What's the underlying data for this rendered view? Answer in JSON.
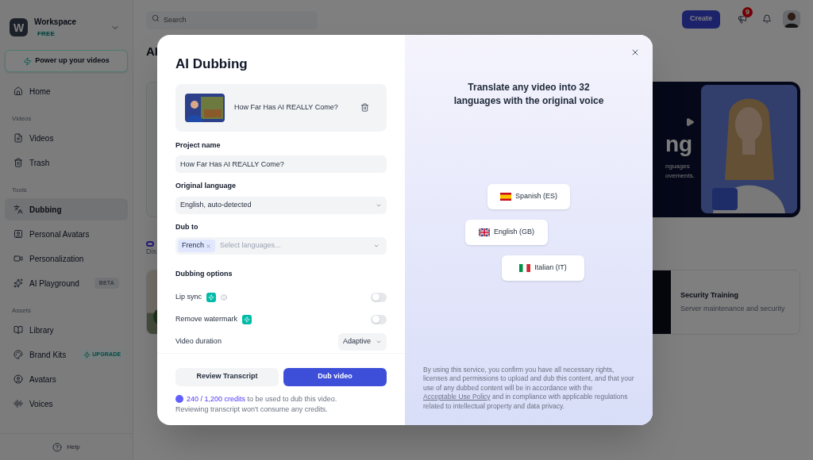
{
  "sidebar": {
    "workspace": {
      "initial": "W",
      "name": "Workspace",
      "plan": "FREE"
    },
    "promo_button": "Power up your videos",
    "sections": [
      {
        "items": [
          {
            "label": "Home",
            "selected": false
          }
        ]
      },
      {
        "heading": "Videos",
        "items": [
          {
            "label": "Videos",
            "selected": false
          },
          {
            "label": "Trash",
            "selected": false
          }
        ]
      },
      {
        "heading": "Tools",
        "items": [
          {
            "label": "Dubbing",
            "selected": true
          },
          {
            "label": "Personal Avatars",
            "selected": false
          },
          {
            "label": "Personalization",
            "selected": false
          },
          {
            "label": "AI Playground",
            "selected": false,
            "badge": {
              "kind": "beta",
              "text": "BETA"
            }
          }
        ]
      },
      {
        "heading": "Assets",
        "items": [
          {
            "label": "Library",
            "selected": false
          },
          {
            "label": "Brand Kits",
            "selected": false,
            "badge": {
              "kind": "upgrade",
              "text": "UPGRADE"
            }
          },
          {
            "label": "Avatars",
            "selected": false
          },
          {
            "label": "Voices",
            "selected": false
          }
        ]
      }
    ],
    "help": "Help"
  },
  "header": {
    "search": {
      "placeholder": "Search"
    },
    "create_button": "Create",
    "notification_count": "9"
  },
  "background": {
    "heading": "AI",
    "hero": {
      "headline": "ng",
      "line_1": "nguages",
      "line_2": "ovements."
    },
    "section_label": "Dis",
    "card": {
      "title": "Security Training",
      "subtitle": "Server maintenance and security"
    }
  },
  "modal": {
    "title": "AI Dubbing",
    "video": {
      "title": "How Far Has AI REALLY Come?"
    },
    "project_name": {
      "label": "Project name",
      "value": "How Far Has AI REALLY Come?"
    },
    "original_language": {
      "label": "Original language",
      "value": "English, auto-detected"
    },
    "dub_to": {
      "label": "Dub to",
      "tags": [
        "French"
      ],
      "placeholder": "Select languages..."
    },
    "options_heading": "Dubbing options",
    "options": [
      {
        "kind": "toggle",
        "label": "Lip sync",
        "premium": true,
        "info": true,
        "on": false
      },
      {
        "kind": "toggle",
        "label": "Remove watermark",
        "premium": true,
        "info": false,
        "on": false
      },
      {
        "kind": "select",
        "label": "Video duration",
        "value": "Adaptive"
      }
    ],
    "buttons": [
      {
        "kind": "secondary",
        "label": "Review Transcript"
      },
      {
        "kind": "primary",
        "label": "Dub video"
      }
    ],
    "credits": {
      "amount": "240 / 1,200 credits",
      "text": " to be used to dub this video.",
      "note": "Reviewing transcript won't consume any credits."
    },
    "promo": {
      "headline": "Translate any video into 32 languages with the original voice",
      "languages": [
        {
          "label": "Spanish (ES)"
        },
        {
          "label": "English (GB)"
        },
        {
          "label": "Italian (IT)"
        }
      ],
      "legal": {
        "before": "By using this service, you confirm you have all necessary rights, licenses and permissions to upload and dub this content, and that your use of any dubbed content will be in accordance with the ",
        "link": "Acceptable Use Policy",
        "after": " and in compliance with applicable regulations related to intellectual property and data privacy."
      }
    }
  }
}
